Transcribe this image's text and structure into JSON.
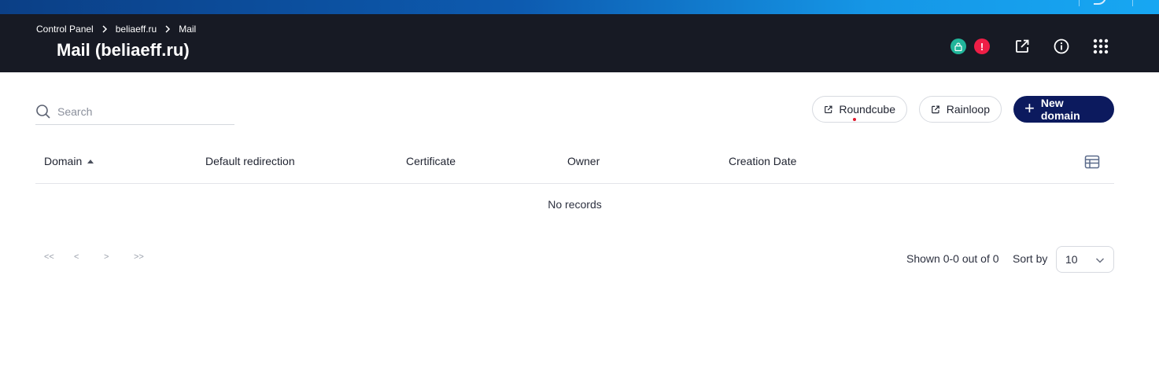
{
  "breadcrumb": {
    "items": [
      "Control Panel",
      "beliaeff.ru",
      "Mail"
    ]
  },
  "page_title": "Mail (beliaeff.ru)",
  "header_icons": [
    "lock-status-icon",
    "alert-icon",
    "external-link-icon",
    "info-icon",
    "apps-grid-icon"
  ],
  "alert_symbol": "!",
  "search": {
    "placeholder": "Search",
    "value": ""
  },
  "actions": {
    "roundcube": "Roundcube",
    "rainloop": "Rainloop",
    "new_domain": "New domain"
  },
  "table": {
    "columns": [
      "Domain",
      "Default redirection",
      "Certificate",
      "Owner",
      "Creation Date"
    ],
    "sorted_column": "Domain",
    "sort_direction": "asc",
    "empty_text": "No records"
  },
  "pagination": {
    "first": "<<",
    "prev": "<",
    "next": ">",
    "last": ">>",
    "shown_text": "Shown 0-0 out of 0",
    "sort_by_label": "Sort by",
    "page_size": "10"
  },
  "colors": {
    "header_bg": "#171a24",
    "primary": "#0c1a5e",
    "status_ok": "#21b59a",
    "status_alert": "#ee1e46"
  }
}
